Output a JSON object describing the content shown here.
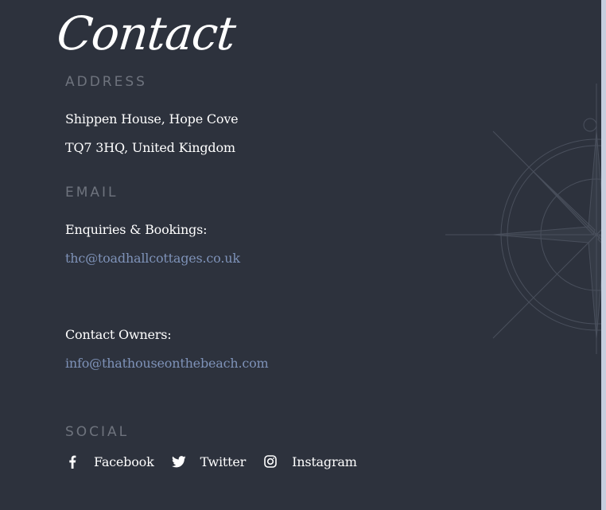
{
  "contact": {
    "heading": "Contact"
  },
  "address": {
    "label": "ADDRESS",
    "line1": "Shippen House, Hope Cove",
    "line2": "TQ7 3HQ, United Kingdom"
  },
  "email": {
    "label": "EMAIL",
    "enquiries_label": "Enquiries & Bookings:",
    "enquiries_email": "thc@toadhallcottages.co.uk",
    "owners_label": "Contact Owners:",
    "owners_email": "info@thathouseonthebeach.com"
  },
  "social": {
    "label": "SOCIAL",
    "items": [
      {
        "label": "Facebook",
        "icon": "facebook-icon"
      },
      {
        "label": "Twitter",
        "icon": "twitter-icon"
      },
      {
        "label": "Instagram",
        "icon": "instagram-icon"
      }
    ]
  },
  "colors": {
    "background": "#2d323d",
    "label": "#6e737d",
    "text": "#ffffff",
    "link": "#7e92b8",
    "edge": "#c5cede"
  }
}
